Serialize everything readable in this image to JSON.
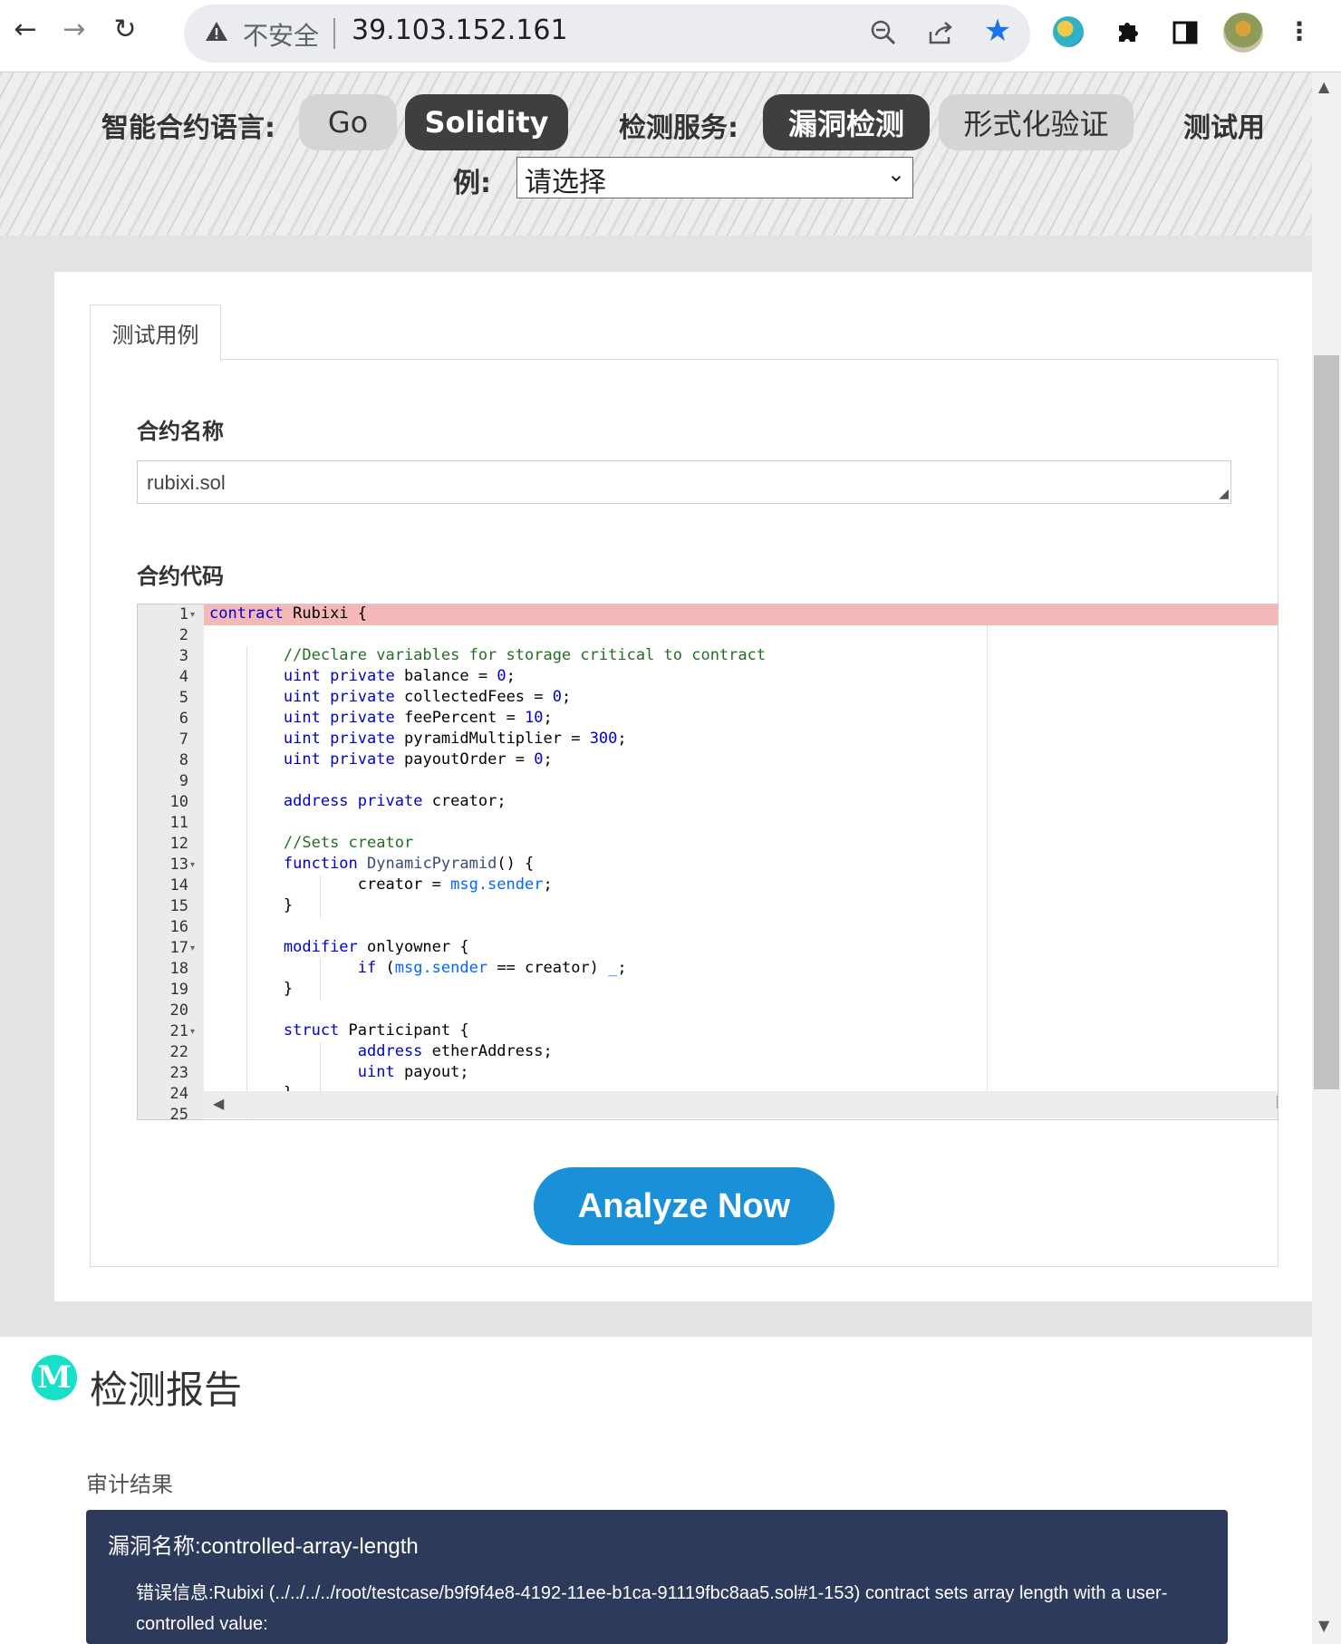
{
  "browser": {
    "insecure_label": "不安全",
    "url": "39.103.152.161"
  },
  "banner": {
    "language_label": "智能合约语言:",
    "languages": [
      "Go",
      "Solidity"
    ],
    "active_language": "Solidity",
    "service_label": "检测服务:",
    "services": [
      "漏洞检测",
      "形式化验证"
    ],
    "active_service": "漏洞检测",
    "testcase_label_part1": "测试用",
    "testcase_label_part2": "例:",
    "testcase_select_value": "请选择"
  },
  "form": {
    "tab_label": "测试用例",
    "contract_name_label": "合约名称",
    "contract_name_value": "rubixi.sol",
    "contract_code_label": "合约代码",
    "highlighted_line": 1,
    "line_numbers": [
      "1",
      "2",
      "3",
      "4",
      "5",
      "6",
      "7",
      "8",
      "9",
      "10",
      "11",
      "12",
      "13",
      "14",
      "15",
      "16",
      "17",
      "18",
      "19",
      "20",
      "21",
      "22",
      "23",
      "24",
      "25"
    ],
    "code_lines": [
      "contract Rubixi {",
      "",
      "        //Declare variables for storage critical to contract",
      "        uint private balance = 0;",
      "        uint private collectedFees = 0;",
      "        uint private feePercent = 10;",
      "        uint private pyramidMultiplier = 300;",
      "        uint private payoutOrder = 0;",
      "",
      "        address private creator;",
      "",
      "        //Sets creator",
      "        function DynamicPyramid() {",
      "                creator = msg.sender;",
      "        }",
      "",
      "        modifier onlyowner {",
      "                if (msg.sender == creator) _;",
      "        }",
      "",
      "        struct Participant {",
      "                address etherAddress;",
      "                uint payout;",
      "        }"
    ],
    "analyze_button": "Analyze Now"
  },
  "report": {
    "title": "检测报告",
    "logo_letter": "M",
    "audit_label": "审计结果",
    "vuln_name": "漏洞名称:controlled-array-length",
    "error_message": "错误信息:Rubixi (../../../../root/testcase/b9f9f4e8-4192-11ee-b1ca-91119fbc8aa5.sol#1-153) contract sets array length with a user-controlled value:"
  },
  "colors": {
    "active_pill": "#3f3f3f",
    "inactive_pill": "#d5d5d5",
    "analyze_button": "#1a90d8",
    "result_box": "#2e3a5b",
    "highlight_line": "#f4b8b8"
  }
}
